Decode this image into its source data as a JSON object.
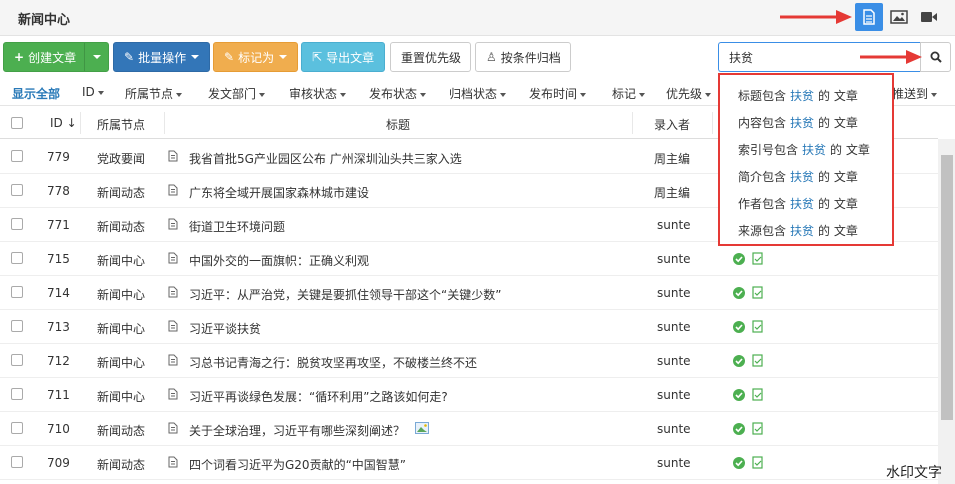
{
  "header": {
    "title": "新闻中心"
  },
  "toolbar": {
    "create": "创建文章",
    "batch": "批量操作",
    "mark_as": "标记为",
    "export": "导出文章",
    "reset_priority": "重置优先级",
    "archive_by_condition": "按条件归档"
  },
  "search": {
    "value": "扶贫"
  },
  "filters": {
    "show_all": "显示全部",
    "items": [
      "ID",
      "所属节点",
      "发文部门",
      "审核状态",
      "发布状态",
      "归档状态",
      "发布时间",
      "标记",
      "优先级",
      "推送到"
    ]
  },
  "table": {
    "headers": {
      "id": "ID",
      "node": "所属节点",
      "title": "标题",
      "author": "录入者"
    },
    "rows": [
      {
        "id": "779",
        "node": "党政要闻",
        "title": "我省首批5G产业园区公布 广州深圳汕头共三家入选",
        "author": "周主编",
        "status": false
      },
      {
        "id": "778",
        "node": "新闻动态",
        "title": "广东将全域开展国家森林城市建设",
        "author": "周主编",
        "status": false
      },
      {
        "id": "771",
        "node": "新闻动态",
        "title": "街道卫生环境问题",
        "author": "sunte",
        "status": false
      },
      {
        "id": "715",
        "node": "新闻中心",
        "title": "中国外交的一面旗帜：正确义利观",
        "author": "sunte",
        "status": true
      },
      {
        "id": "714",
        "node": "新闻中心",
        "title": "习近平：从严治党，关键是要抓住领导干部这个“关键少数”",
        "author": "sunte",
        "status": true
      },
      {
        "id": "713",
        "node": "新闻中心",
        "title": "习近平谈扶贫",
        "author": "sunte",
        "status": true
      },
      {
        "id": "712",
        "node": "新闻中心",
        "title": "习总书记青海之行：脱贫攻坚再攻坚，不破楼兰终不还",
        "author": "sunte",
        "status": true
      },
      {
        "id": "711",
        "node": "新闻中心",
        "title": "习近平再谈绿色发展：“循环利用”之路该如何走?",
        "author": "sunte",
        "status": true
      },
      {
        "id": "710",
        "node": "新闻动态",
        "title": "关于全球治理，习近平有哪些深刻阐述？",
        "author": "sunte",
        "status": true,
        "image": true
      },
      {
        "id": "709",
        "node": "新闻动态",
        "title": "四个词看习近平为G20贡献的“中国智慧”",
        "author": "sunte",
        "status": true
      }
    ]
  },
  "dropdown": {
    "keyword": "扶贫",
    "items": [
      {
        "prefix": "标题包含",
        "suffix": "的 文章"
      },
      {
        "prefix": "内容包含",
        "suffix": "的 文章"
      },
      {
        "prefix": "索引号包含",
        "suffix": "的 文章"
      },
      {
        "prefix": "简介包含",
        "suffix": "的 文章"
      },
      {
        "prefix": "作者包含",
        "suffix": "的 文章"
      },
      {
        "prefix": "来源包含",
        "suffix": "的 文章"
      }
    ]
  },
  "watermark": "水印文字",
  "colors": {
    "accent": "#3a8ee6",
    "highlight_border": "#e53935",
    "ok": "#4caf50"
  },
  "icons": [
    "file-text-icon",
    "image-icon",
    "video-icon",
    "search-icon",
    "plus-icon",
    "pencil-icon",
    "tag-icon",
    "share-icon",
    "stamp-icon",
    "check-circle-icon",
    "review-icon"
  ]
}
